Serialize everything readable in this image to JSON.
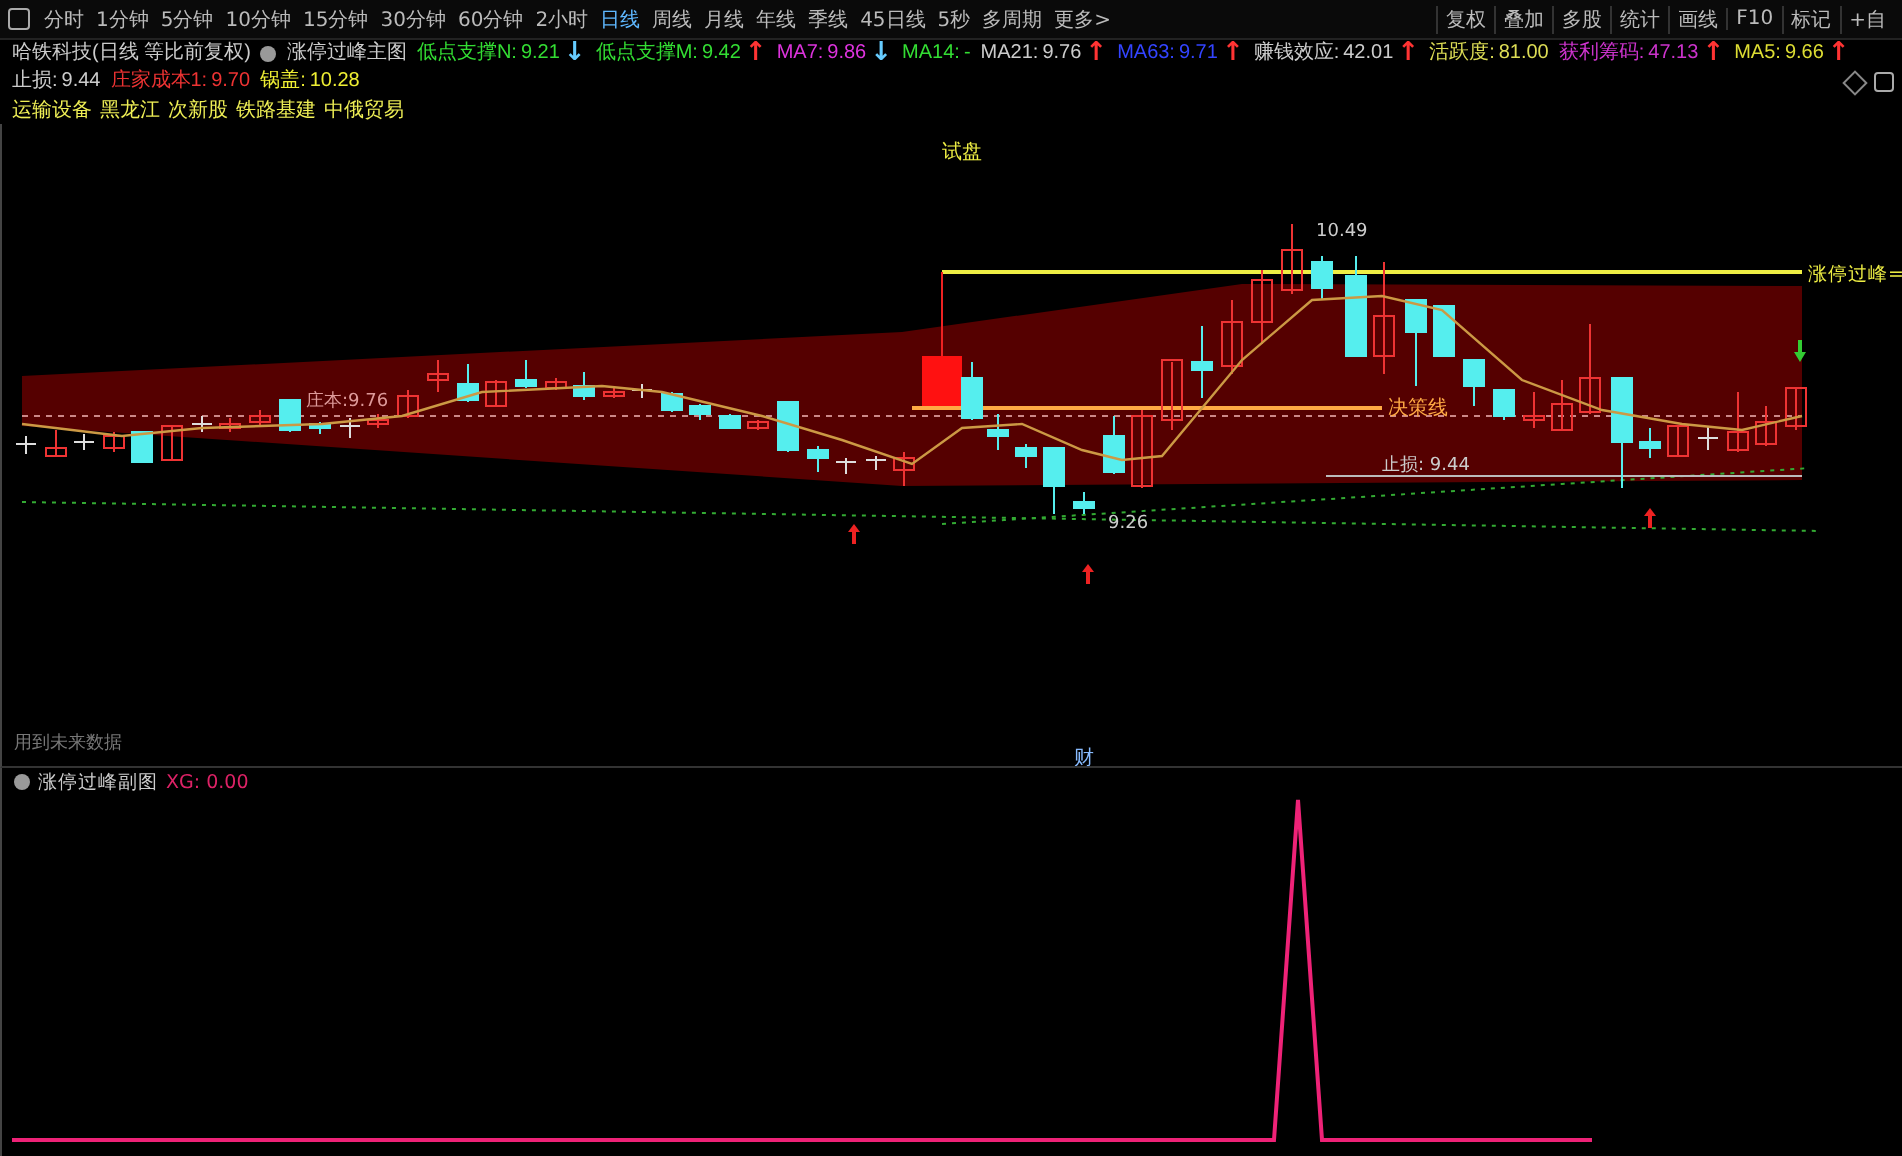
{
  "toolbar": {
    "periods": [
      {
        "label": "分时",
        "selected": false
      },
      {
        "label": "1分钟",
        "selected": false
      },
      {
        "label": "5分钟",
        "selected": false
      },
      {
        "label": "10分钟",
        "selected": false
      },
      {
        "label": "15分钟",
        "selected": false
      },
      {
        "label": "30分钟",
        "selected": false
      },
      {
        "label": "60分钟",
        "selected": false
      },
      {
        "label": "2小时",
        "selected": false
      },
      {
        "label": "日线",
        "selected": true
      },
      {
        "label": "周线",
        "selected": false
      },
      {
        "label": "月线",
        "selected": false
      },
      {
        "label": "年线",
        "selected": false
      },
      {
        "label": "季线",
        "selected": false
      },
      {
        "label": "45日线",
        "selected": false
      },
      {
        "label": "5秒",
        "selected": false
      },
      {
        "label": "多周期",
        "selected": false
      },
      {
        "label": "更多>",
        "selected": false
      }
    ],
    "tools": [
      "复权",
      "叠加",
      "多股",
      "统计",
      "画线",
      "F10",
      "标记",
      "+自"
    ]
  },
  "info": {
    "title": "哈铁科技(日线 等比前复权)",
    "indicator_name": "涨停过峰主图",
    "values": [
      {
        "label": "低点支撑N:",
        "value": "9.21",
        "arrow": {
          "text": "↓",
          "color": "#66ccff"
        },
        "color": "#33dd33"
      },
      {
        "label": "低点支撑M:",
        "value": "9.42",
        "arrow": {
          "text": "↑",
          "color": "#ff3333"
        },
        "color": "#33dd33"
      },
      {
        "label": "MA7:",
        "value": "9.86",
        "arrow": {
          "text": "↓",
          "color": "#66ccff"
        },
        "color": "#dd33dd"
      },
      {
        "label": "MA14:",
        "value": "-",
        "color": "#33dd33"
      },
      {
        "label": "MA21:",
        "value": "9.76",
        "arrow": {
          "text": "↑",
          "color": "#ff3333"
        },
        "color": "#cccccc"
      },
      {
        "label": "MA63:",
        "value": "9.71",
        "arrow": {
          "text": "↑",
          "color": "#ff3333"
        },
        "color": "#3344ff"
      },
      {
        "label": "赚钱效应:",
        "value": "42.01",
        "arrow": {
          "text": "↑",
          "color": "#ff3333"
        },
        "color": "#cccccc"
      },
      {
        "label": "活跃度:",
        "value": "81.00",
        "color": "#dddd55"
      },
      {
        "label": "获利筹码:",
        "value": "47.13",
        "arrow": {
          "text": "↑",
          "color": "#ff3333"
        },
        "color": "#cc33cc"
      },
      {
        "label": "MA5:",
        "value": "9.66",
        "arrow": {
          "text": "↑",
          "color": "#ff3333"
        },
        "color": "#dddd33"
      },
      {
        "label": "止损:",
        "value": "9.44",
        "color": "#cccccc"
      },
      {
        "label": "庄家成本1:",
        "value": "9.70",
        "color": "#ee3333"
      },
      {
        "label": "锅盖:",
        "value": "10.28",
        "color": "#eeee33"
      }
    ]
  },
  "tags": [
    "运输设备",
    "黑龙江",
    "次新股",
    "铁路基建",
    "中俄贸易"
  ],
  "main_chart": {
    "trial_label": "试盘",
    "cost_label": "庄本:9.76",
    "high_label": "10.49",
    "low_label": "9.26",
    "decision_label": "决策线",
    "stop_label": "止损: 9.44",
    "peak_label": "涨停过峰=",
    "finance_mark": "财",
    "note": "用到未来数据"
  },
  "sub_chart": {
    "name": "涨停过峰副图",
    "reading": "XG: 0.00"
  }
}
